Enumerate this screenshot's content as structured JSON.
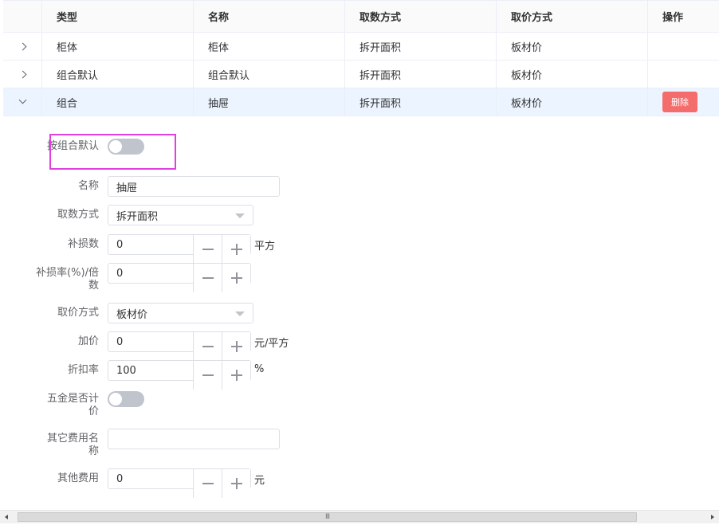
{
  "table": {
    "headers": [
      "类型",
      "名称",
      "取数方式",
      "取价方式",
      "操作"
    ],
    "rows": [
      {
        "type": "柜体",
        "name": "柜体",
        "take_method": "拆开面积",
        "price_method": "板材价",
        "expanded": false
      },
      {
        "type": "组合默认",
        "name": "组合默认",
        "take_method": "拆开面积",
        "price_method": "板材价",
        "expanded": false
      },
      {
        "type": "组合",
        "name": "抽屉",
        "take_method": "拆开面积",
        "price_method": "板材价",
        "expanded": true,
        "action_label": "删除"
      }
    ]
  },
  "form": {
    "default_combo_label": "按组合默认",
    "default_combo_on": false,
    "name_label": "名称",
    "name_value": "抽屉",
    "take_method_label": "取数方式",
    "take_method_value": "拆开面积",
    "loss_label": "补损数",
    "loss_value": "0",
    "loss_unit": "平方",
    "loss_rate_label": "补损率(%)/倍数",
    "loss_rate_value": "0",
    "price_method_label": "取价方式",
    "price_method_value": "板材价",
    "add_price_label": "加价",
    "add_price_value": "0",
    "add_price_unit": "元/平方",
    "discount_label": "折扣率",
    "discount_value": "100",
    "discount_unit": "%",
    "hardware_label": "五金是否计价",
    "hardware_on": false,
    "other_fee_name_label": "其它费用名称",
    "other_fee_name_value": "",
    "other_fee_label": "其他费用",
    "other_fee_value": "0",
    "other_fee_unit": "元"
  },
  "scrollbar": {
    "thumb_glyph": "III"
  },
  "colors": {
    "accent_danger": "#f56c6c",
    "highlight": "#e040e0",
    "row_active": "#ecf5ff"
  }
}
